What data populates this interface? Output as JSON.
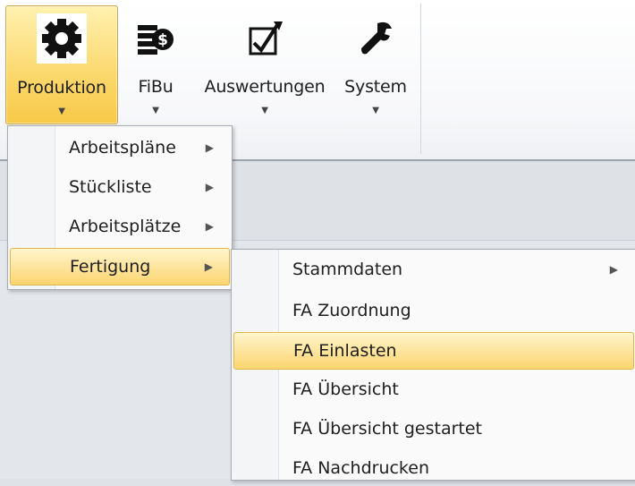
{
  "ribbon": {
    "buttons": [
      {
        "label": "Produktion",
        "icon": "gear-icon"
      },
      {
        "label": "FiBu",
        "icon": "money-stack-icon"
      },
      {
        "label": "Auswertungen",
        "icon": "checkbox-chart-icon"
      },
      {
        "label": "System",
        "icon": "wrench-icon"
      }
    ]
  },
  "menu1": {
    "items": [
      {
        "label": "Arbeitspläne"
      },
      {
        "label": "Stückliste"
      },
      {
        "label": "Arbeitsplätze"
      },
      {
        "label": "Fertigung"
      }
    ]
  },
  "menu2": {
    "items": [
      {
        "label": "Stammdaten"
      },
      {
        "label": "FA Zuordnung"
      },
      {
        "label": "FA Einlasten"
      },
      {
        "label": "FA Übersicht"
      },
      {
        "label": "FA Übersicht gestartet"
      },
      {
        "label": "FA Nachdrucken"
      }
    ]
  },
  "colors": {
    "accent": "#fbd76b",
    "highlight_border": "#e3b84a",
    "ribbon_bg": "#f7f8fa"
  }
}
